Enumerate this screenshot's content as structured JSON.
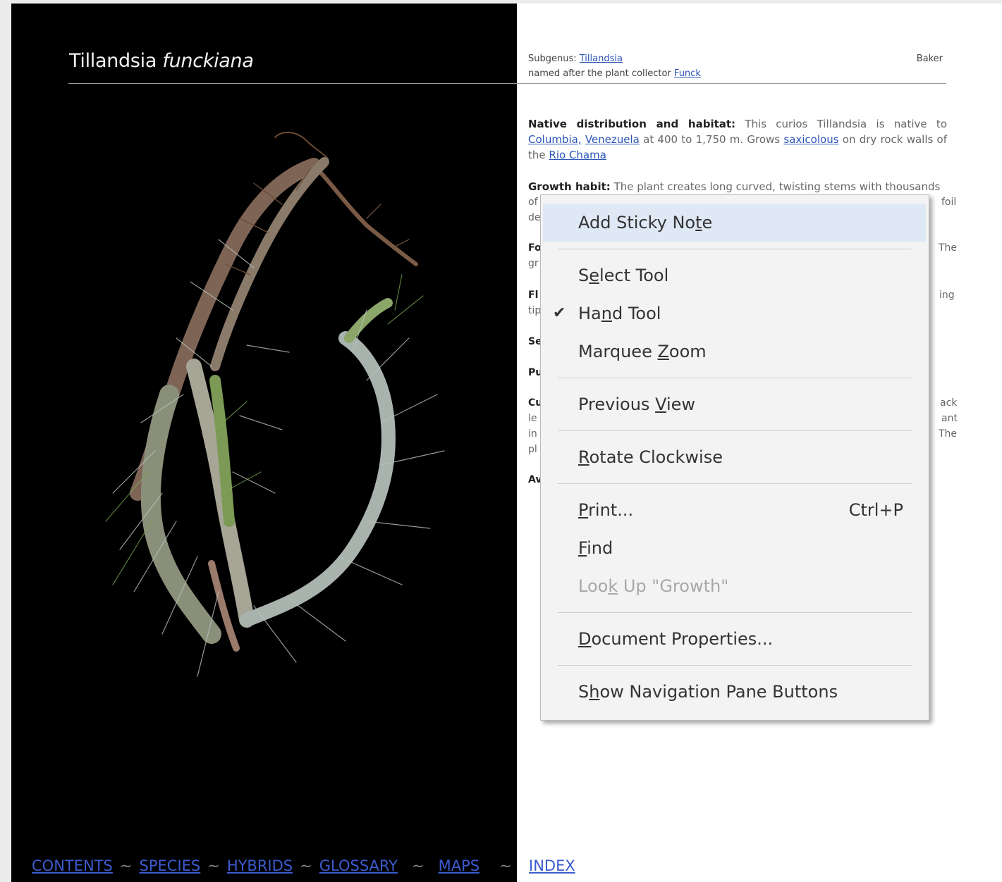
{
  "header": {
    "title_genus": "Tillandsia",
    "title_species": "funckiana",
    "subgenus_label": "Subgenus:",
    "subgenus_link": "Tillandsia",
    "named_after_text": "named after the plant collector",
    "named_after_link": "Funck",
    "author": "Baker"
  },
  "paragraphs": {
    "native_label": "Native distribution and habitat:",
    "native_text_1": "This curios Tillandsia is native to",
    "native_link_1": "Columbia,",
    "native_link_2": "Venezuela",
    "native_text_2": "at 400 to 1,750 m. Grows",
    "native_link_3": "saxicolous",
    "native_text_3": "on dry rock walls of the",
    "native_link_4": "Rio Chama",
    "growth_label": "Growth habit:",
    "growth_text": "The plant creates long curved, twisting stems with thousands",
    "frag_of": "of",
    "frag_foil": "foil",
    "frag_de": "de",
    "frag_fo": "Fo",
    "frag_the1": "The",
    "frag_gr": "gr",
    "frag_fl": "Fl",
    "frag_ing": "ing",
    "frag_tip": "tip",
    "frag_se": "Se",
    "frag_pu": "Pu",
    "frag_cu": "Cu",
    "frag_ack": "ack",
    "frag_le": "le",
    "frag_ant": "ant",
    "frag_in": "in",
    "frag_the2": "The",
    "frag_pl": "pl",
    "frag_av": "Av"
  },
  "context_menu": {
    "items": [
      {
        "label": "Add Sticky Note",
        "mnemonic_before": "Add Sticky No",
        "mnemonic_char": "t",
        "mnemonic_after": "e"
      },
      {
        "label": "Select Tool",
        "mnemonic_before": "S",
        "mnemonic_char": "e",
        "mnemonic_after": "lect Tool"
      },
      {
        "label": "Hand Tool",
        "mnemonic_before": "Ha",
        "mnemonic_char": "n",
        "mnemonic_after": "d Tool",
        "checked": true
      },
      {
        "label": "Marquee Zoom",
        "mnemonic_before": "Marquee ",
        "mnemonic_char": "Z",
        "mnemonic_after": "oom"
      },
      {
        "label": "Previous View",
        "mnemonic_before": "Previous ",
        "mnemonic_char": "V",
        "mnemonic_after": "iew"
      },
      {
        "label": "Rotate Clockwise",
        "mnemonic_before": "",
        "mnemonic_char": "R",
        "mnemonic_after": "otate Clockwise"
      },
      {
        "label": "Print...",
        "mnemonic_before": "",
        "mnemonic_char": "P",
        "mnemonic_after": "rint...",
        "shortcut": "Ctrl+P"
      },
      {
        "label": "Find",
        "mnemonic_before": "",
        "mnemonic_char": "F",
        "mnemonic_after": "ind"
      },
      {
        "label": "Look Up \"Growth\"",
        "mnemonic_before": "Loo",
        "mnemonic_char": "k",
        "mnemonic_after": " Up \"Growth\"",
        "disabled": true
      },
      {
        "label": "Document Properties...",
        "mnemonic_before": "",
        "mnemonic_char": "D",
        "mnemonic_after": "ocument Properties..."
      },
      {
        "label": "Show Navigation Pane Buttons",
        "mnemonic_before": "S",
        "mnemonic_char": "h",
        "mnemonic_after": "ow Navigation Pane Buttons"
      }
    ],
    "check_glyph": "✔"
  },
  "footer_nav": {
    "contents": "CONTENTS",
    "species": "SPECIES",
    "hybrids": "HYBRIDS",
    "glossary": "GLOSSARY",
    "maps": "MAPS",
    "index": "INDEX",
    "separator": "~"
  },
  "colors": {
    "link": "#2b55b5",
    "nav_link": "#3b5bcf",
    "menu_bg": "#f3f3f3",
    "menu_hover": "#dfe9f5"
  }
}
